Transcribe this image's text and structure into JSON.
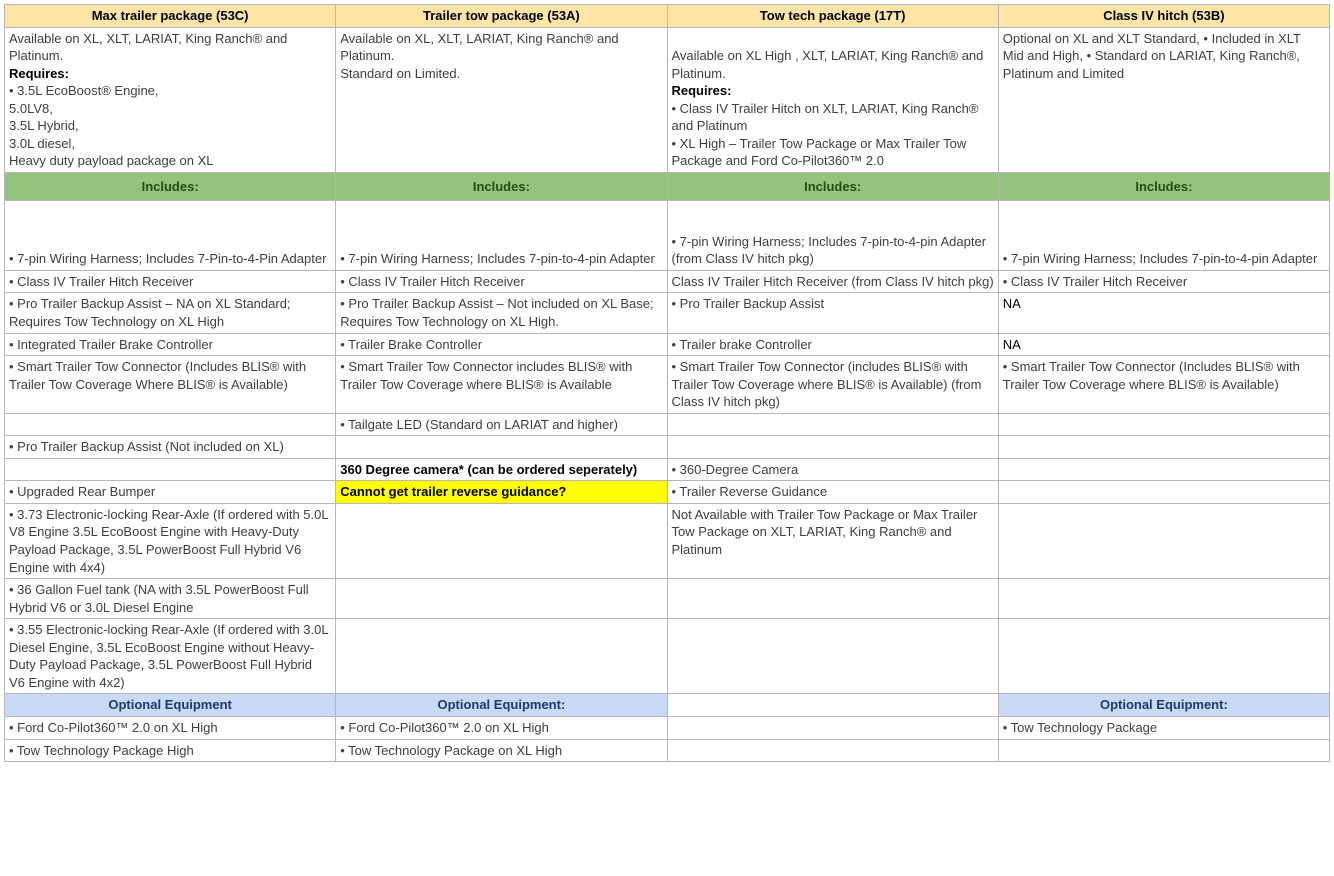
{
  "headers": {
    "c1": "Max trailer package (53C)",
    "c2": "Trailer tow package (53A)",
    "c3": "Tow tech package (17T)",
    "c4": "Class IV hitch (53B)"
  },
  "avail": {
    "c1_line1": "Available on XL, XLT, LARIAT, King Ranch® and Platinum.",
    "c1_req_label": "Requires:",
    "c1_req_body": "• 3.5L EcoBoost® Engine,\n5.0LV8,\n3.5L Hybrid,\n3.0L diesel,\nHeavy duty payload package on XL",
    "c2": "Available on XL, XLT, LARIAT, King Ranch® and Platinum.\nStandard on Limited.",
    "c3_line1": "Available on XL High , XLT, LARIAT, King Ranch® and Platinum.",
    "c3_req_label": "Requires:",
    "c3_req1": "• Class IV Trailer Hitch on XLT, LARIAT, King Ranch® and Platinum",
    "c3_req2": "• XL High – Trailer Tow Package or Max Trailer Tow Package and Ford Co-Pilot360™ 2.0",
    "c4": "Optional on XL and XLT Standard, • Included in XLT Mid and High, • Standard on LARIAT, King Ranch®, Platinum and Limited"
  },
  "includes_label": "Includes:",
  "rows": [
    {
      "c1": "• 7-pin Wiring Harness; Includes 7-Pin-to-4-Pin Adapter",
      "c2": "• 7-pin Wiring Harness; Includes 7-pin-to-4-pin Adapter",
      "c3": "• 7-pin Wiring Harness; Includes 7-pin-to-4-pin Adapter (from Class IV hitch pkg)",
      "c4": "• 7-pin Wiring Harness; Includes 7-pin-to-4-pin Adapter",
      "tall": true
    },
    {
      "c1": "• Class IV Trailer Hitch Receiver",
      "c2": "• Class IV Trailer Hitch Receiver",
      "c3": "Class IV Trailer Hitch Receiver (from Class IV hitch pkg)",
      "c4": "• Class IV Trailer Hitch Receiver"
    },
    {
      "c1": "• Pro Trailer Backup Assist – NA on XL Standard; Requires Tow Technology on XL High",
      "c2": "• Pro Trailer Backup Assist – Not included on XL Base; Requires Tow Technology on XL High.",
      "c3": "• Pro Trailer Backup Assist",
      "c4": "NA",
      "c4black": true
    },
    {
      "c1": "• Integrated Trailer Brake Controller",
      "c2": "• Trailer Brake Controller",
      "c3": "• Trailer brake Controller",
      "c4": "NA",
      "c4black": true
    },
    {
      "c1": "• Smart Trailer Tow Connector (Includes BLIS® with Trailer Tow Coverage Where BLIS® is Available)",
      "c2": "• Smart Trailer Tow Connector includes BLIS® with Trailer Tow Coverage where BLIS® is Available",
      "c3": "• Smart Trailer Tow Connector (includes BLIS® with Trailer Tow Coverage where BLIS® is Available) (from Class IV hitch pkg)",
      "c4": "• Smart Trailer Tow Connector (Includes BLIS® with Trailer Tow Coverage where BLIS® is Available)"
    },
    {
      "c1": "",
      "c2": "• Tailgate LED (Standard on LARIAT and higher)",
      "c3": "",
      "c4": ""
    },
    {
      "c1": "• Pro Trailer Backup Assist (Not included on XL)",
      "c2": "",
      "c3": "",
      "c4": ""
    },
    {
      "c1": "",
      "c2": "360 Degree camera* (can be ordered seperately)",
      "c2bold": true,
      "c3": "• 360-Degree Camera",
      "c4": ""
    },
    {
      "c1": "• Upgraded Rear Bumper",
      "c2": "Cannot get trailer reverse guidance?",
      "c2highlight": true,
      "c3": "• Trailer Reverse Guidance",
      "c4": ""
    },
    {
      "c1": "• 3.73 Electronic-locking Rear-Axle (If ordered with 5.0L V8 Engine 3.5L EcoBoost Engine with Heavy-Duty Payload Package, 3.5L PowerBoost Full Hybrid V6 Engine with 4x4)",
      "c2": "",
      "c3": "Not Available with Trailer Tow Package or Max Trailer Tow Package on XLT, LARIAT, King Ranch® and Platinum",
      "c4": ""
    },
    {
      "c1": "• 36 Gallon Fuel tank (NA with 3.5L PowerBoost Full Hybrid V6 or 3.0L Diesel Engine",
      "c2": "",
      "c3": "",
      "c4": ""
    },
    {
      "c1": "• 3.55 Electronic-locking Rear-Axle (If ordered with 3.0L Diesel Engine, 3.5L EcoBoost Engine without Heavy-Duty Payload Package, 3.5L PowerBoost Full Hybrid V6 Engine with 4x2)",
      "c2": "",
      "c3": "",
      "c4": ""
    }
  ],
  "optional_header": {
    "c1": "Optional Equipment",
    "c2": "Optional Equipment:",
    "c3": "",
    "c4": "Optional Equipment:"
  },
  "optional_rows": [
    {
      "c1": "• Ford Co-Pilot360™ 2.0 on XL High",
      "c2": "• Ford Co-Pilot360™ 2.0 on XL High",
      "c3": "",
      "c4": "• Tow Technology Package"
    },
    {
      "c1": "• Tow Technology Package High",
      "c2": "• Tow Technology Package on XL High",
      "c3": "",
      "c4": ""
    }
  ]
}
